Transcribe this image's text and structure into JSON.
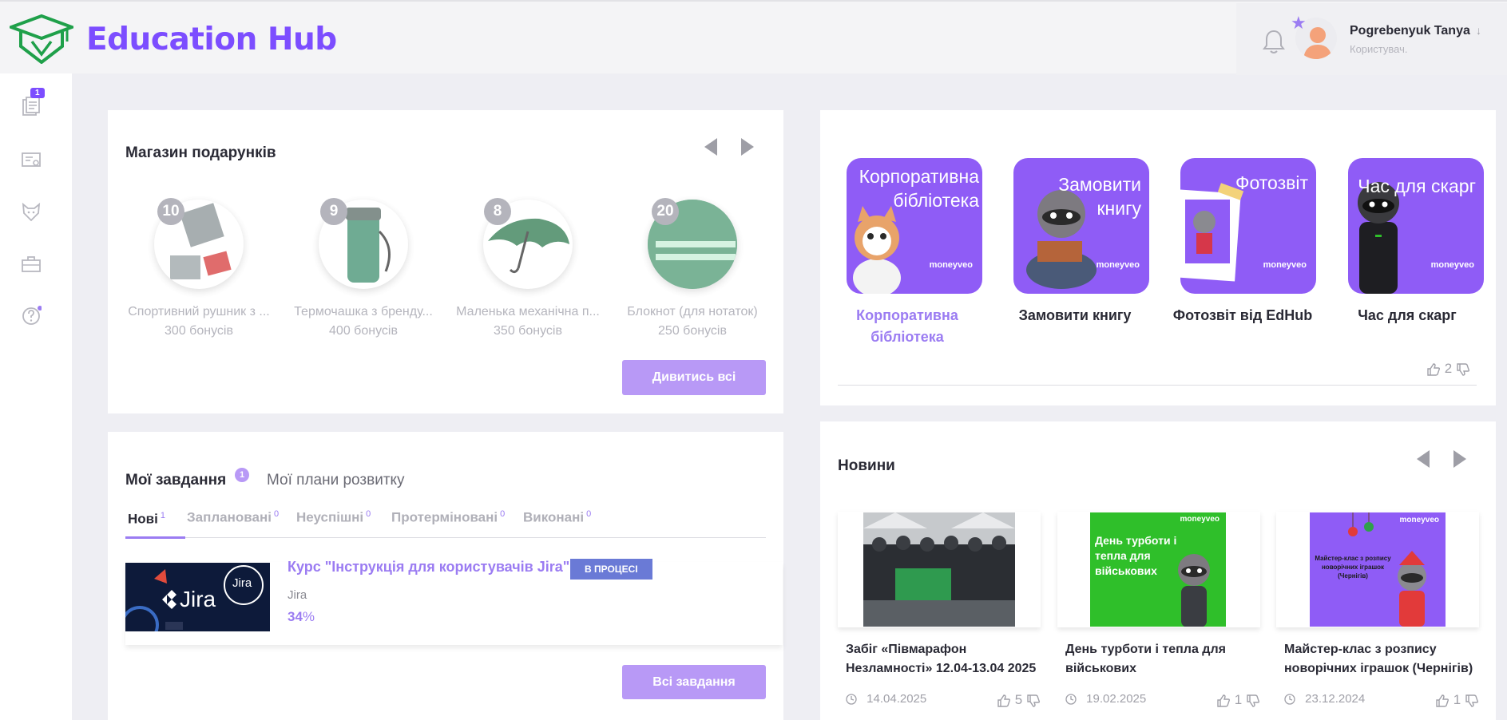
{
  "app": {
    "title": "Education Hub"
  },
  "user": {
    "name": "Pogrebenyuk Tanya",
    "role": "Користувач.",
    "avatar_badge_icon": "star-icon"
  },
  "sidebar": {
    "items": [
      {
        "icon": "tasks-icon",
        "badge": "1"
      },
      {
        "icon": "certificate-icon"
      },
      {
        "icon": "fox-icon"
      },
      {
        "icon": "briefcase-icon"
      },
      {
        "icon": "help-icon"
      }
    ]
  },
  "gift_shop": {
    "title": "Магазин подарунків",
    "view_all": "Дивитись всі",
    "items": [
      {
        "count": "10",
        "name": "Спортивний рушник з ...",
        "price": "300 бонусів"
      },
      {
        "count": "9",
        "name": "Термочашка з бренду...",
        "price": "400 бонусів"
      },
      {
        "count": "8",
        "name": "Маленька механічна п...",
        "price": "350 бонусів"
      },
      {
        "count": "20",
        "name": "Блокнот (для нотаток)",
        "price": "250 бонусів"
      }
    ]
  },
  "tasks": {
    "title": "Мої завдання",
    "title_badge": "1",
    "second_tab": "Мої плани розвитку",
    "tabs": [
      {
        "label": "Нові",
        "count": "1"
      },
      {
        "label": "Заплановані",
        "count": "0"
      },
      {
        "label": "Неуспішні",
        "count": "0"
      },
      {
        "label": "Протерміновані",
        "count": "0"
      },
      {
        "label": "Виконані",
        "count": "0"
      }
    ],
    "item": {
      "title": "Курс \"Інструкція для користувачів Jira\"",
      "status": "В ПРОЦЕСІ",
      "category": "Jira",
      "progress_value": "34",
      "progress_unit": "%",
      "thumb_text": "Jira",
      "thumb_text_2": "Jira"
    },
    "all_button": "Всі завдання"
  },
  "tiles": {
    "items": [
      {
        "text": "Корпоративна бібліотека",
        "label": "Корпоративна бібліотека",
        "brand": "moneyveo"
      },
      {
        "text": "Замовити книгу",
        "label": "Замовити книгу",
        "brand": "moneyveo"
      },
      {
        "text": "Фотозвіт",
        "label": "Фотозвіт від EdHub",
        "brand": "moneyveo"
      },
      {
        "text": "Час для скарг",
        "label": "Час для скарг",
        "brand": "moneyveo"
      }
    ],
    "likes": "2"
  },
  "news": {
    "title": "Новини",
    "items": [
      {
        "title": "Забіг «Півмарафон Незламності» 12.04-13.04 2025",
        "date": "14.04.2025",
        "likes": "5"
      },
      {
        "title": "День турботи і тепла для військових",
        "date": "19.02.2025",
        "likes": "1",
        "img_text": "День турботи і тепла для військових",
        "img_brand": "moneyveo"
      },
      {
        "title": "Майстер-клас з розпису новорічних іграшок (Чернігів)",
        "date": "23.12.2024",
        "likes": "1",
        "img_text": "Майстер-клас з розпису новорічних іграшок (Чернігів)",
        "img_brand": "moneyveo"
      }
    ]
  },
  "colors": {
    "accent": "#7c4dff",
    "tile": "#8f5cf6",
    "button": "#b899f6",
    "status": "#6a7ad6",
    "green": "#2fbf2a"
  }
}
